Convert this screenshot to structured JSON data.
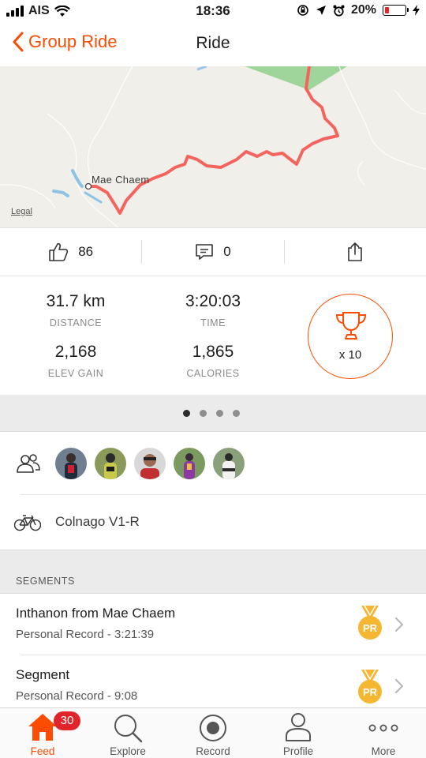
{
  "status_bar": {
    "carrier": "AIS",
    "time": "18:36",
    "battery_percent": "20%",
    "battery_level": 0.2
  },
  "nav": {
    "back_label": "Group Ride",
    "title": "Ride"
  },
  "map": {
    "place_label": "Mae Chaem",
    "legal_label": "Legal",
    "route_color": "#f4645f"
  },
  "social": {
    "kudos_count": "86",
    "comments_count": "0"
  },
  "stats": {
    "distance_value": "31.7 km",
    "distance_label": "DISTANCE",
    "time_value": "3:20:03",
    "time_label": "TIME",
    "elev_value": "2,168",
    "elev_label": "ELEV GAIN",
    "calories_value": "1,865",
    "calories_label": "CALORIES",
    "achievements": "x 10"
  },
  "pager": {
    "pages": 4,
    "active_index": 0
  },
  "participants": {
    "count": 5
  },
  "bike": {
    "name": "Colnago V1-R"
  },
  "segments": {
    "header": "SEGMENTS",
    "items": [
      {
        "name": "Inthanon from Mae Chaem",
        "detail": "Personal Record - 3:21:39",
        "medal": "PR"
      },
      {
        "name": "Segment",
        "detail": "Personal Record - 9:08",
        "medal": "PR"
      }
    ]
  },
  "tabs": [
    {
      "label": "Feed",
      "icon": "home-icon",
      "badge": "30",
      "active": true
    },
    {
      "label": "Explore",
      "icon": "search-icon"
    },
    {
      "label": "Record",
      "icon": "record-icon"
    },
    {
      "label": "Profile",
      "icon": "profile-icon"
    },
    {
      "label": "More",
      "icon": "more-icon"
    }
  ],
  "colors": {
    "accent": "#fc4c02",
    "badge": "#e0242a",
    "medal": "#f5b731"
  }
}
